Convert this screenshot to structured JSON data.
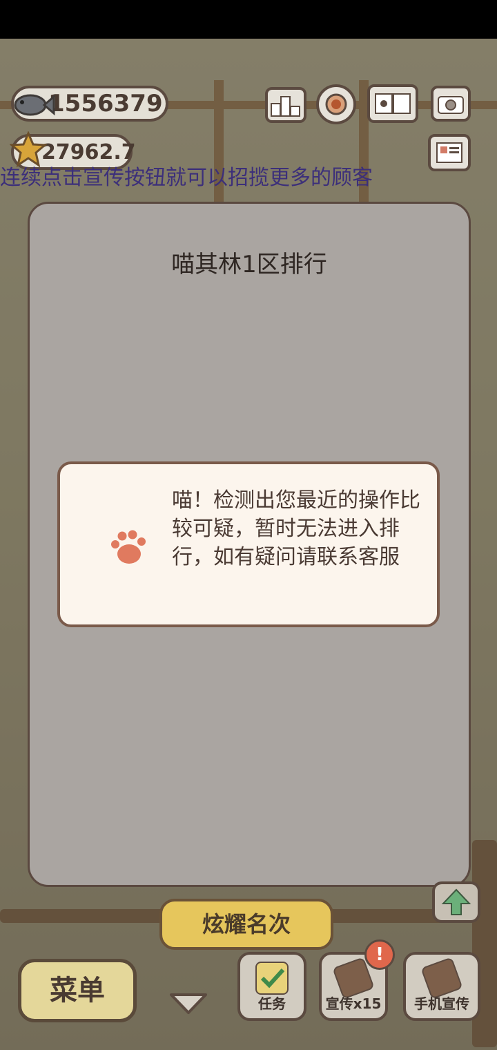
{
  "currency": {
    "fish": "1556379",
    "star": "27962.7"
  },
  "hint_text": "连续点击宣传按钮就可以招揽更多的顾客",
  "top_icons": [
    "ranking-icon",
    "settings-icon",
    "book-icon",
    "camera-icon",
    "newspaper-icon"
  ],
  "ranking_panel": {
    "title": "喵其林1区排行"
  },
  "alert": {
    "message": "喵！检测出您最近的操作比较可疑，暂时无法进入排行，如有疑问请联系客服"
  },
  "boast_button": "炫耀名次",
  "bottom_bar": {
    "menu_label": "菜单",
    "task_label": "任务",
    "promo_label": "宣传x15",
    "promo_badge": "!",
    "phone_label": "手机宣传"
  },
  "colors": {
    "accent": "#e6c65c",
    "paw": "#e07a5f",
    "badge": "#e0674c"
  }
}
